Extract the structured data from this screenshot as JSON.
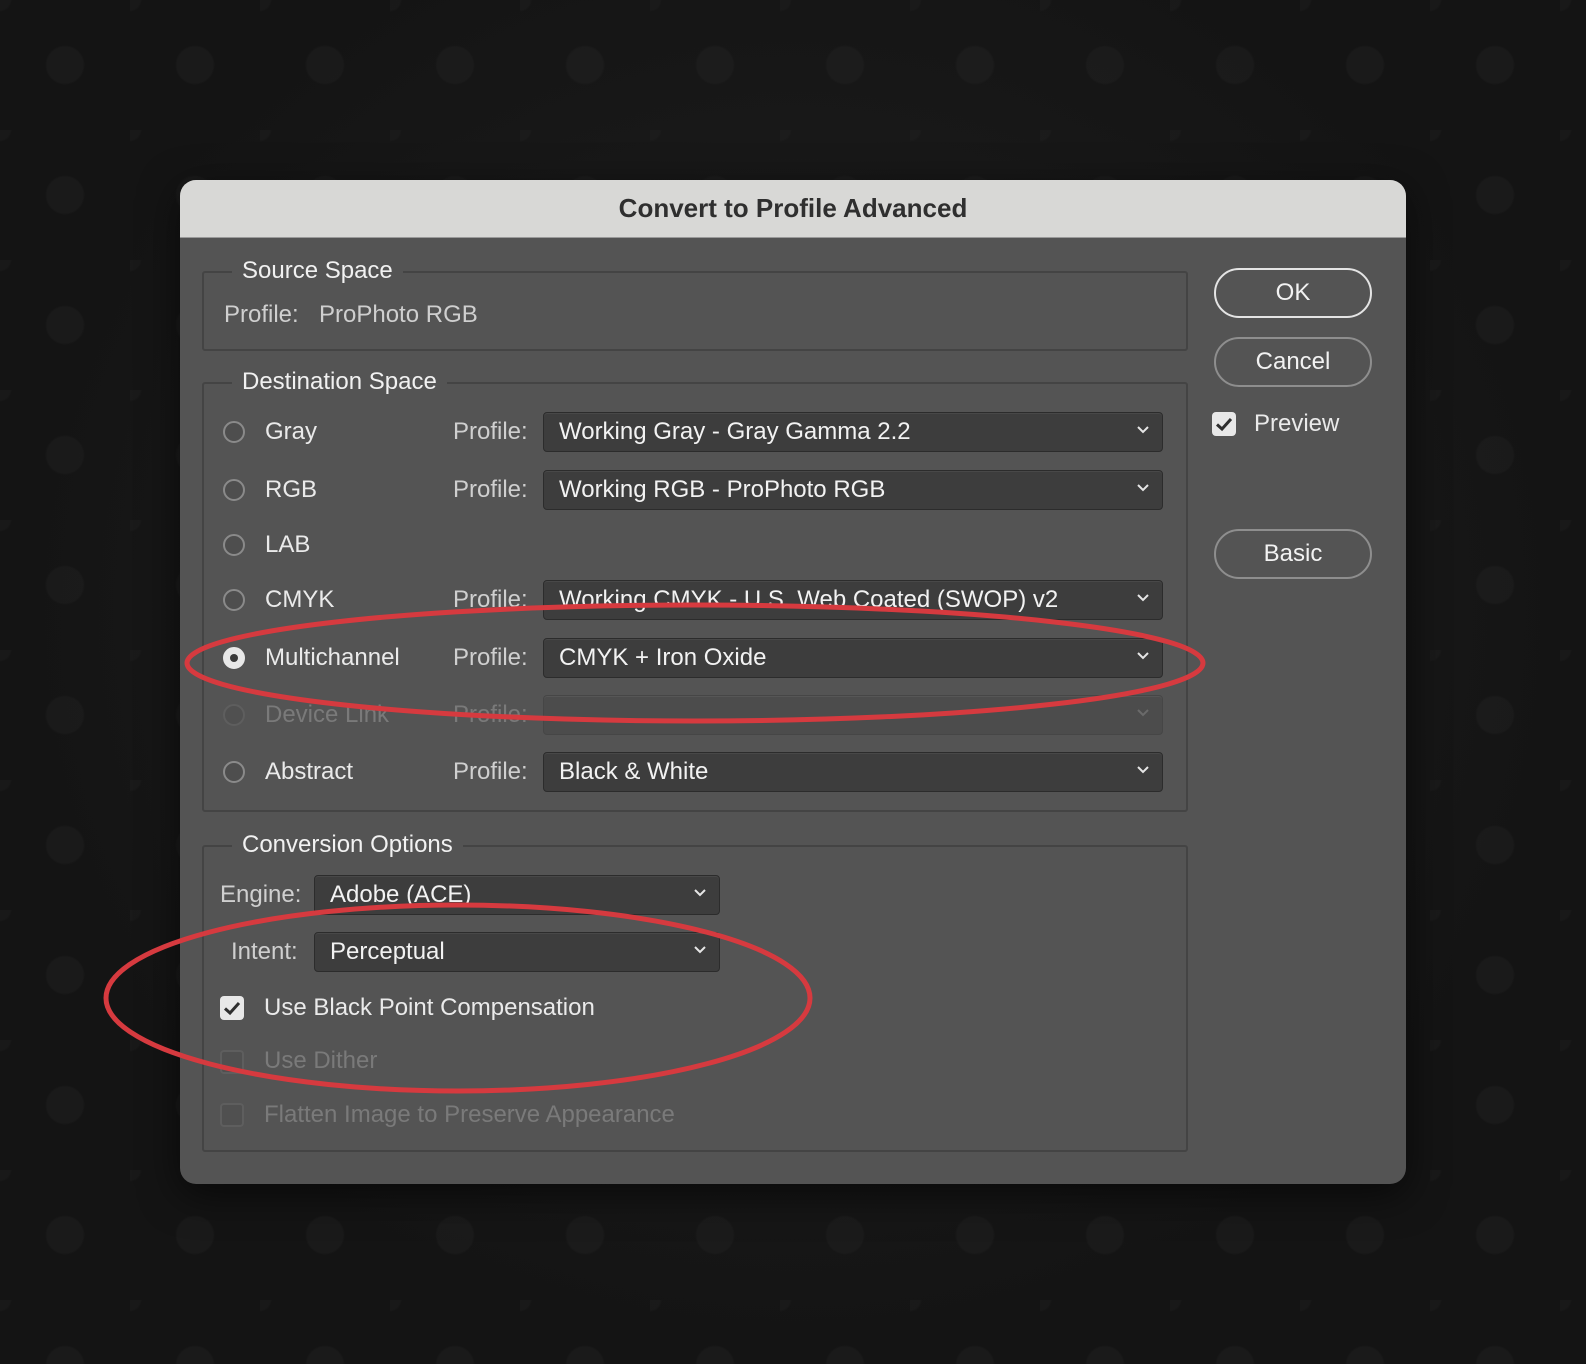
{
  "dialog": {
    "title": "Convert to Profile Advanced"
  },
  "source": {
    "legend": "Source Space",
    "profile_label": "Profile:",
    "profile_value": "ProPhoto RGB"
  },
  "destination": {
    "legend": "Destination Space",
    "profile_label": "Profile:",
    "options": [
      {
        "label": "Gray",
        "profile": "Working Gray - Gray Gamma 2.2",
        "selected": false,
        "enabled": true
      },
      {
        "label": "RGB",
        "profile": "Working RGB - ProPhoto RGB",
        "selected": false,
        "enabled": true
      },
      {
        "label": "LAB",
        "profile": "",
        "selected": false,
        "enabled": true
      },
      {
        "label": "CMYK",
        "profile": "Working CMYK - U.S. Web Coated (SWOP) v2",
        "selected": false,
        "enabled": true
      },
      {
        "label": "Multichannel",
        "profile": "CMYK + Iron Oxide",
        "selected": true,
        "enabled": true
      },
      {
        "label": "Device Link",
        "profile": "",
        "selected": false,
        "enabled": false
      },
      {
        "label": "Abstract",
        "profile": "Black & White",
        "selected": false,
        "enabled": true
      }
    ]
  },
  "conversion": {
    "legend": "Conversion Options",
    "engine_label": "Engine:",
    "engine_value": "Adobe (ACE)",
    "intent_label": "Intent:",
    "intent_value": "Perceptual",
    "black_point": {
      "label": "Use Black Point Compensation",
      "checked": true,
      "enabled": true
    },
    "dither": {
      "label": "Use Dither",
      "checked": false,
      "enabled": false
    },
    "flatten": {
      "label": "Flatten Image to Preserve Appearance",
      "checked": false,
      "enabled": false
    }
  },
  "buttons": {
    "ok": "OK",
    "cancel": "Cancel",
    "basic": "Basic",
    "preview_label": "Preview",
    "preview_checked": true
  },
  "colors": {
    "dialog_bg": "#545454",
    "titlebar_bg": "#d8d8d6",
    "annotation_red": "#d63a3f"
  }
}
